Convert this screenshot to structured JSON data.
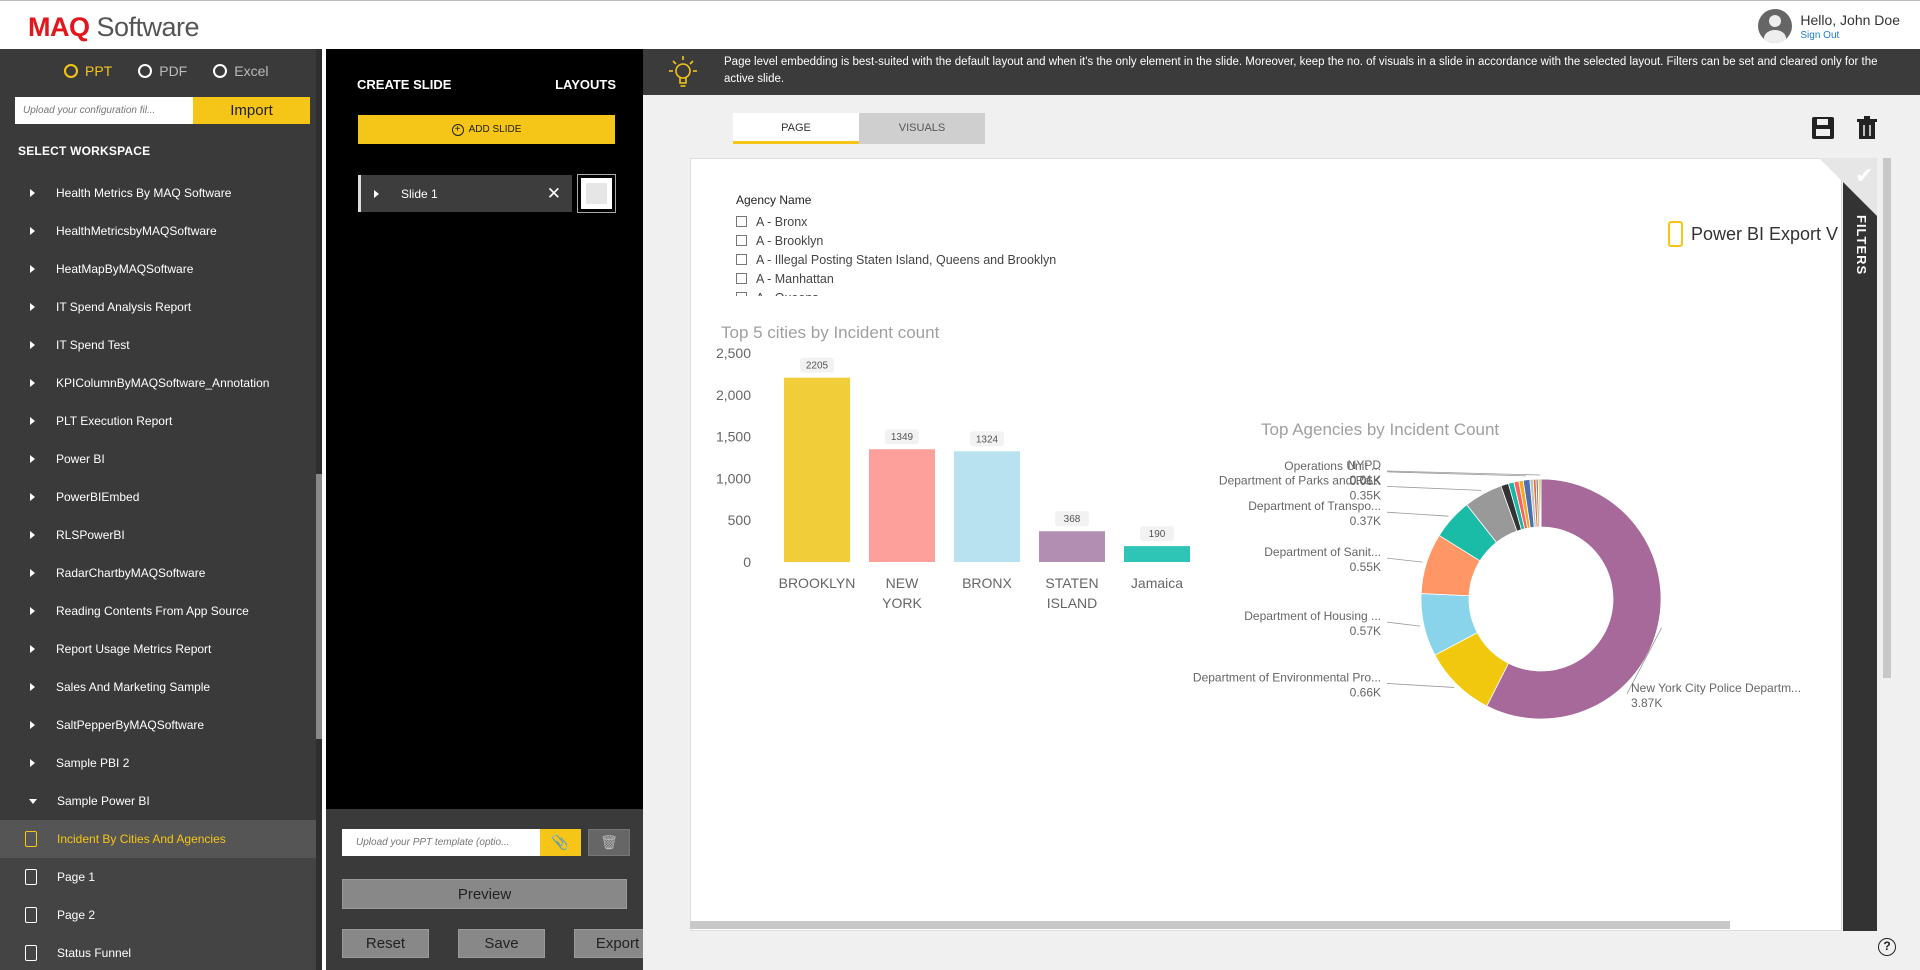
{
  "header": {
    "logo_brand": "MAQ",
    "logo_rest": " Software",
    "greeting": "Hello, John Doe",
    "sign_out": "Sign Out"
  },
  "sidebar": {
    "formats": [
      {
        "label": "PPT",
        "selected": true
      },
      {
        "label": "PDF",
        "selected": false
      },
      {
        "label": "Excel",
        "selected": false
      }
    ],
    "config_placeholder": "Upload your configuration fil...",
    "import_label": "Import",
    "workspace_title": "SELECT WORKSPACE",
    "workspaces": [
      "Health Metrics By MAQ Software",
      "HealthMetricsbyMAQSoftware",
      "HeatMapByMAQSoftware",
      "IT Spend Analysis Report",
      "IT Spend Test",
      "KPIColumnByMAQSoftware_Annotation",
      "PLT Execution Report",
      "Power BI",
      "PowerBIEmbed",
      "RLSPowerBI",
      "RadarChartbyMAQSoftware",
      "Reading Contents From App Source",
      "Report Usage Metrics Report",
      "Sales And Marketing Sample",
      "SaltPepperByMAQSoftware",
      "Sample PBI 2",
      "Sample Power BI"
    ],
    "pages": [
      {
        "label": "Incident By Cities And Agencies",
        "active": true
      },
      {
        "label": "Page 1",
        "active": false
      },
      {
        "label": "Page 2",
        "active": false
      },
      {
        "label": "Status Funnel",
        "active": false
      }
    ]
  },
  "slides": {
    "create_title": "CREATE SLIDE",
    "layouts_title": "LAYOUTS",
    "add_label": "ADD SLIDE",
    "items": [
      "Slide 1"
    ],
    "template_placeholder": "Upload your PPT template (optio...",
    "preview": "Preview",
    "reset": "Reset",
    "save": "Save",
    "export": "Export"
  },
  "notice": "Page level embedding is best-suited with the default layout and when it's the only element in the slide. Moreover, keep the no. of visuals in a slide in accordance with the selected layout. Filters can be set and cleared only for the active slide.",
  "tabs": [
    {
      "label": "PAGE",
      "active": true
    },
    {
      "label": "VISUALS",
      "active": false
    }
  ],
  "report": {
    "slicer_title": "Agency Name",
    "slicer_items": [
      "A - Bronx",
      "A - Brooklyn",
      "A - Illegal Posting Staten Island, Queens and Brooklyn",
      "A - Manhattan",
      "A - Queens"
    ],
    "export_label": "Power BI Export V",
    "filters_label": "FILTERS"
  },
  "colors": {
    "accent": "#f5c518",
    "dark": "#3a3a3a",
    "link": "#1e7ad1"
  },
  "chart_data": [
    {
      "type": "bar",
      "title": "Top 5 cities by Incident count",
      "categories": [
        "BROOKLYN",
        "NEW YORK",
        "BRONX",
        "STATEN ISLAND",
        "Jamaica"
      ],
      "values": [
        2205,
        1349,
        1324,
        368,
        190
      ],
      "colors": [
        "#f2cd3a",
        "#fd9f9b",
        "#b9e2f1",
        "#b28eb3",
        "#2ec4b6"
      ],
      "ylim": [
        0,
        2500
      ],
      "yticks": [
        "0",
        "500",
        "1,000",
        "1,500",
        "2,000",
        "2,500"
      ],
      "ytick_values": [
        0,
        500,
        1000,
        1500,
        2000,
        2500
      ],
      "grid": false
    },
    {
      "type": "pie",
      "title": "Top Agencies by Incident Count",
      "slices": [
        {
          "label": "New York City Police Departm...",
          "value_label": "3.87K",
          "value": 3870,
          "color": "#a66999"
        },
        {
          "label": "Department of Environmental Pro...",
          "value_label": "0.66K",
          "value": 660,
          "color": "#f2c80f"
        },
        {
          "label": "Department of Housing ...",
          "value_label": "0.57K",
          "value": 570,
          "color": "#8ad4eb"
        },
        {
          "label": "Department of Sanit...",
          "value_label": "0.55K",
          "value": 550,
          "color": "#fe9666"
        },
        {
          "label": "Department of Transpo...",
          "value_label": "0.37K",
          "value": 370,
          "color": "#1abca8"
        },
        {
          "label": "Department of Parks and Re...",
          "value_label": "0.35K",
          "value": 350,
          "color": "#999999"
        },
        {
          "label": "",
          "value_label": "",
          "value": 70,
          "color": "#333333"
        },
        {
          "label": "",
          "value_label": "",
          "value": 50,
          "color": "#1bb5a5"
        },
        {
          "label": "",
          "value_label": "",
          "value": 45,
          "color": "#fd625e"
        },
        {
          "label": "",
          "value_label": "",
          "value": 40,
          "color": "#f5a623"
        },
        {
          "label": "Operations Unit ...",
          "value_label": "0.06K",
          "value": 60,
          "color": "#4b6fb5"
        },
        {
          "label": "",
          "value_label": "",
          "value": 30,
          "color": "#c0c0c0"
        },
        {
          "label": "",
          "value_label": "",
          "value": 25,
          "color": "#e66c37"
        },
        {
          "label": "",
          "value_label": "",
          "value": 20,
          "color": "#7f8c8d"
        },
        {
          "label": "",
          "value_label": "",
          "value": 15,
          "color": "#d9b300"
        },
        {
          "label": "NYPD",
          "value_label": "0.01K",
          "value": 10,
          "color": "#555555"
        }
      ]
    }
  ]
}
